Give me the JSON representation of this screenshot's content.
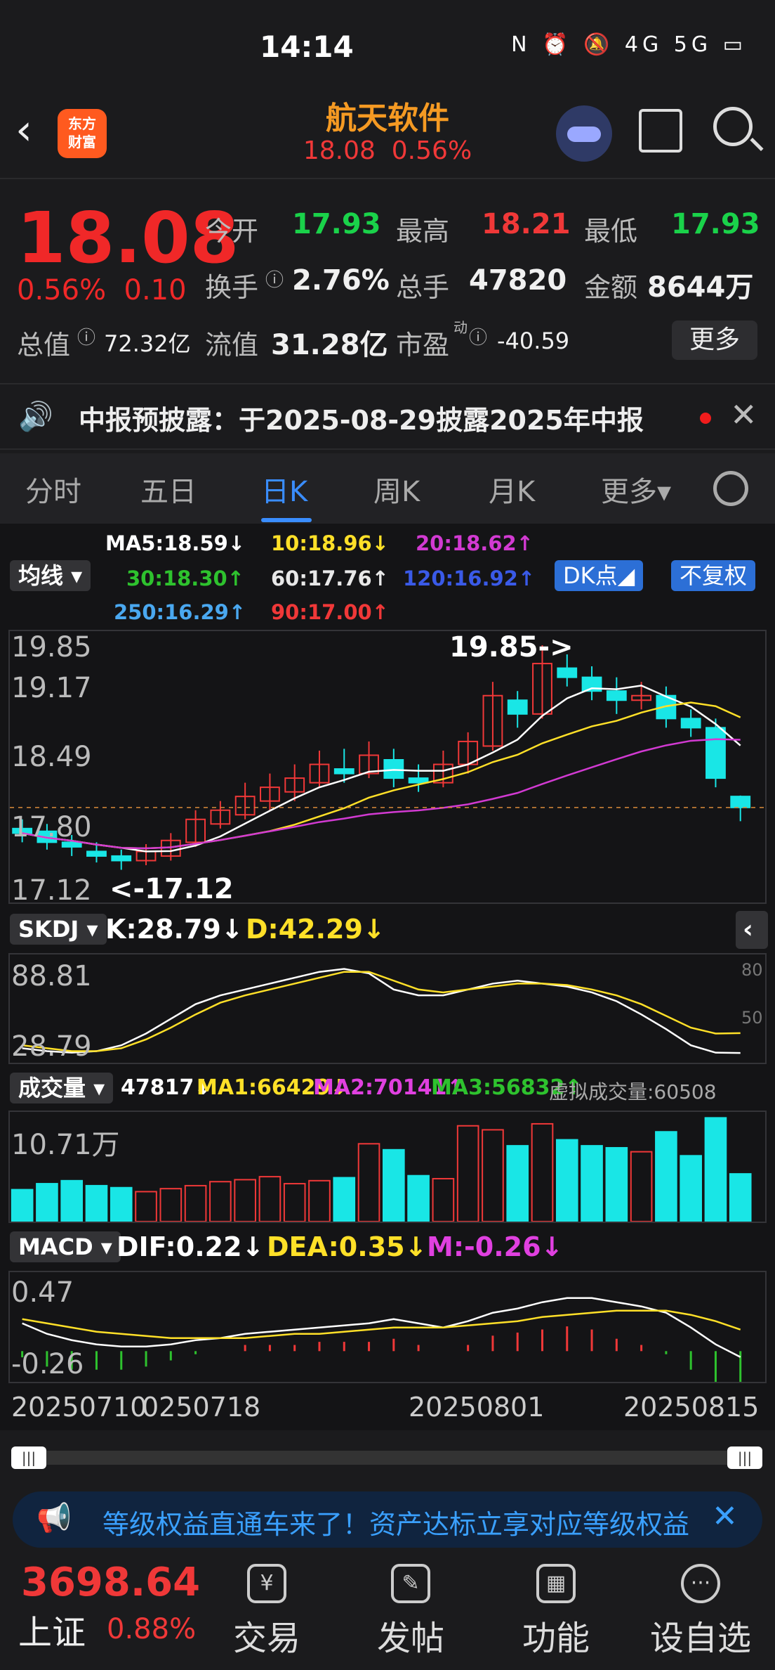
{
  "status": {
    "time": "14:14",
    "icons": "N ⏰ 🔕 4G 5G ▭"
  },
  "header": {
    "logo_line1": "东方",
    "logo_line2": "财富",
    "name": "航天软件",
    "sub_price": "18.08",
    "sub_pct": "0.56%"
  },
  "quote": {
    "price": "18.08",
    "pct": "0.56%",
    "chg": "0.10",
    "open_label": "今开",
    "open": "17.93",
    "high_label": "最高",
    "high": "18.21",
    "low_label": "最低",
    "low": "17.93",
    "turnover_label": "换手",
    "turnover": "2.76%",
    "volume_label": "总手",
    "volume": "47820",
    "amount_label": "金额",
    "amount": "8644万",
    "mktcap_label": "总值",
    "mktcap": "72.32亿",
    "float_label": "流值",
    "float": "31.28亿",
    "pe_label": "市盈",
    "pe_sup": "动",
    "pe": "-40.59",
    "more": "更多"
  },
  "notice": {
    "text": "中报预披露：于2025-08-29披露2025年中报"
  },
  "tabs": [
    "分时",
    "五日",
    "日K",
    "周K",
    "月K",
    "更多▾"
  ],
  "ma": {
    "dropdown": "均线",
    "ma5": "MA5:18.59↓",
    "ma10": "10:18.96↓",
    "ma20": "20:18.62↑",
    "ma30": "30:18.30↑",
    "ma60": "60:17.76↑",
    "ma120": "120:16.92↑",
    "ma250": "250:16.29↑",
    "ma90": "90:17.00↑",
    "dk": "DK点◢",
    "adj": "不复权"
  },
  "kchart": {
    "y_top": "19.85",
    "y_2": "19.17",
    "y_3": "18.49",
    "y_4": "17.80",
    "y_bot": "17.12",
    "hi_note": "19.85->",
    "lo_note": "<-17.12"
  },
  "skdj": {
    "name": "SKDJ",
    "k": "K:28.79↓",
    "d": "D:42.29↓",
    "y_top": "88.81",
    "y_bot": "28.79",
    "r80": "80",
    "r50": "50"
  },
  "vol": {
    "name": "成交量",
    "v": "47817↓",
    "ma1": "MA1:66429↓",
    "ma2": "MA2:70141↑",
    "ma3": "MA3:56832↑",
    "virt": "虚拟成交量:60508",
    "y_top": "10.71万"
  },
  "macd": {
    "name": "MACD",
    "dif": "DIF:0.22↓",
    "dea": "DEA:0.35↓",
    "m": "M:-0.26↓",
    "y_top": "0.47",
    "y_bot": "-0.26"
  },
  "dates": {
    "d1": "20250710",
    "d2": "0250718",
    "d3": "20250801",
    "d4": "20250815"
  },
  "banner": {
    "text": "等级权益直通车来了！资产达标立享对应等级权益"
  },
  "bottom": {
    "index_val": "3698.64",
    "index_name": "上证",
    "index_pct": "0.88%",
    "nav": [
      "交易",
      "发帖",
      "功能",
      "设自选"
    ]
  },
  "chart_data": {
    "type": "candlestick",
    "y_range": [
      17.12,
      19.85
    ],
    "candles": [
      [
        17.85,
        17.8,
        17.95,
        17.7
      ],
      [
        17.82,
        17.7,
        17.9,
        17.62
      ],
      [
        17.7,
        17.65,
        17.78,
        17.55
      ],
      [
        17.6,
        17.55,
        17.7,
        17.48
      ],
      [
        17.55,
        17.5,
        17.62,
        17.4
      ],
      [
        17.5,
        17.6,
        17.68,
        17.45
      ],
      [
        17.55,
        17.72,
        17.8,
        17.5
      ],
      [
        17.7,
        17.95,
        18.05,
        17.65
      ],
      [
        17.9,
        18.05,
        18.15,
        17.85
      ],
      [
        18.0,
        18.2,
        18.35,
        17.95
      ],
      [
        18.15,
        18.3,
        18.45,
        18.05
      ],
      [
        18.25,
        18.4,
        18.55,
        18.15
      ],
      [
        18.35,
        18.55,
        18.7,
        18.3
      ],
      [
        18.5,
        18.45,
        18.72,
        18.35
      ],
      [
        18.45,
        18.65,
        18.8,
        18.4
      ],
      [
        18.6,
        18.4,
        18.72,
        18.3
      ],
      [
        18.4,
        18.35,
        18.55,
        18.25
      ],
      [
        18.35,
        18.55,
        18.7,
        18.3
      ],
      [
        18.55,
        18.8,
        18.9,
        18.45
      ],
      [
        18.75,
        19.3,
        19.45,
        18.7
      ],
      [
        19.25,
        19.1,
        19.35,
        18.95
      ],
      [
        19.1,
        19.65,
        19.85,
        19.05
      ],
      [
        19.6,
        19.5,
        19.75,
        19.4
      ],
      [
        19.5,
        19.35,
        19.62,
        19.25
      ],
      [
        19.35,
        19.25,
        19.5,
        19.1
      ],
      [
        19.25,
        19.3,
        19.45,
        19.15
      ],
      [
        19.3,
        19.05,
        19.4,
        18.95
      ],
      [
        19.05,
        18.95,
        19.15,
        18.85
      ],
      [
        18.95,
        18.4,
        19.05,
        18.3
      ],
      [
        18.2,
        18.08,
        18.21,
        17.93
      ]
    ],
    "skdj_k": [
      32,
      30,
      29,
      30,
      34,
      42,
      52,
      62,
      68,
      72,
      76,
      80,
      84,
      86,
      83,
      72,
      68,
      68,
      72,
      76,
      78,
      76,
      74,
      70,
      64,
      55,
      45,
      34,
      29,
      28.79
    ],
    "skdj_d": [
      34,
      32,
      30,
      30,
      32,
      38,
      46,
      55,
      63,
      68,
      72,
      76,
      80,
      84,
      84,
      78,
      72,
      70,
      72,
      74,
      76,
      76,
      75,
      72,
      68,
      62,
      54,
      46,
      42,
      42.29
    ],
    "volume": [
      32000,
      38000,
      41000,
      36000,
      34000,
      30000,
      33000,
      36000,
      40000,
      42000,
      45000,
      38000,
      41000,
      44000,
      78000,
      72000,
      46000,
      43000,
      96000,
      92000,
      76000,
      98000,
      82000,
      76000,
      74000,
      70000,
      90000,
      66000,
      104000,
      47817
    ],
    "macd_dif": [
      0.38,
      0.33,
      0.3,
      0.28,
      0.27,
      0.27,
      0.28,
      0.3,
      0.31,
      0.33,
      0.34,
      0.35,
      0.36,
      0.37,
      0.38,
      0.4,
      0.38,
      0.36,
      0.39,
      0.43,
      0.45,
      0.48,
      0.5,
      0.5,
      0.48,
      0.46,
      0.43,
      0.36,
      0.28,
      0.22
    ],
    "macd_dea": [
      0.4,
      0.38,
      0.36,
      0.34,
      0.33,
      0.32,
      0.31,
      0.31,
      0.31,
      0.31,
      0.32,
      0.33,
      0.33,
      0.34,
      0.35,
      0.36,
      0.36,
      0.36,
      0.37,
      0.38,
      0.39,
      0.41,
      0.42,
      0.43,
      0.44,
      0.44,
      0.44,
      0.42,
      0.39,
      0.35
    ]
  }
}
